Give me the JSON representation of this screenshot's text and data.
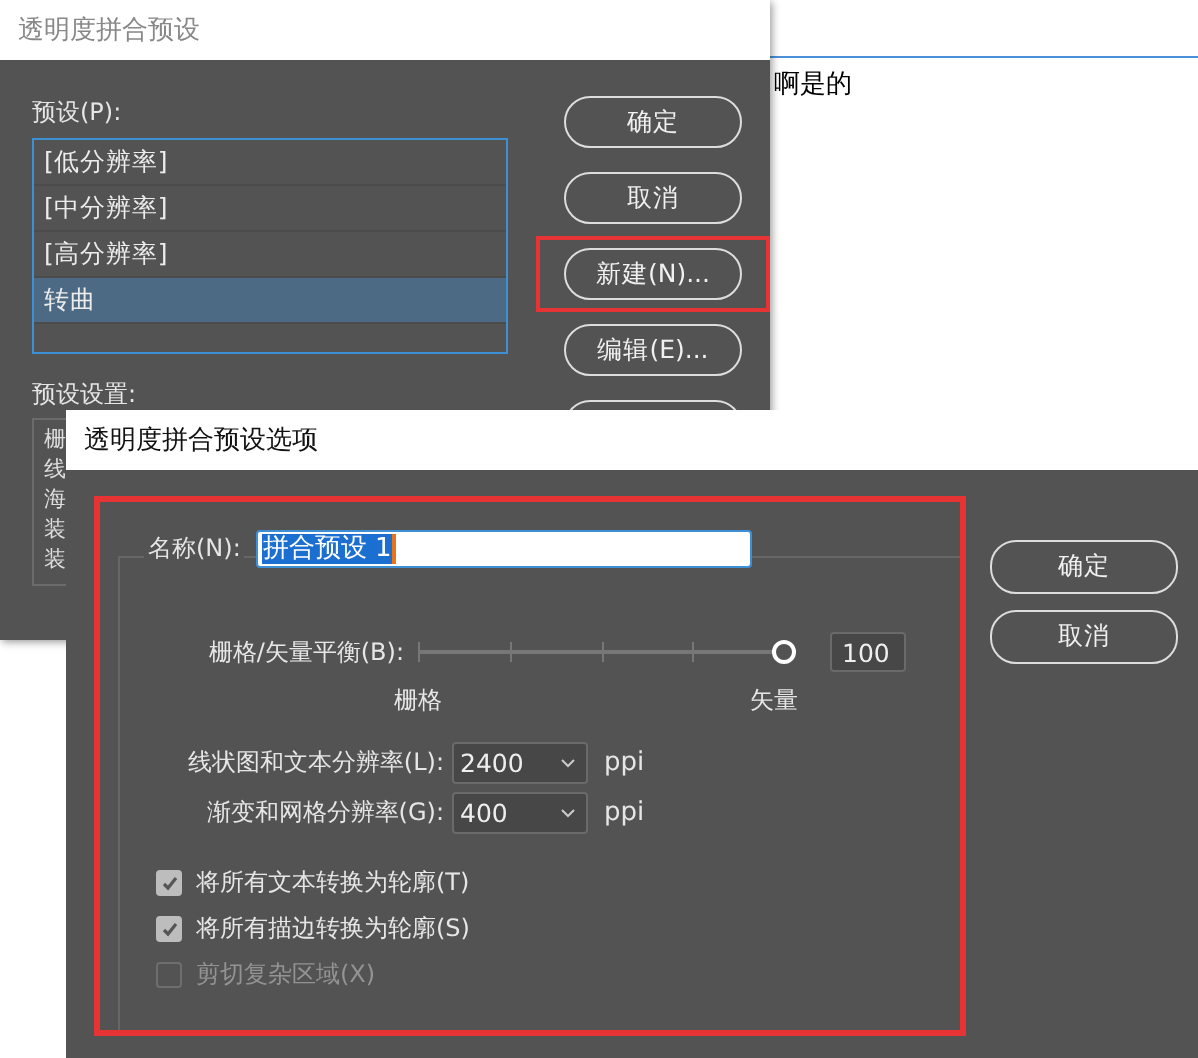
{
  "background_document": {
    "text": "啊是的"
  },
  "preset_dialog": {
    "title": "透明度拼合预设",
    "presets_label": "预设(P):",
    "presets": [
      {
        "label": "[低分辨率]",
        "selected": false
      },
      {
        "label": "[中分辨率]",
        "selected": false
      },
      {
        "label": "[高分辨率]",
        "selected": false
      },
      {
        "label": "转曲",
        "selected": true
      }
    ],
    "buttons": [
      {
        "label": "确定",
        "highlighted": false
      },
      {
        "label": "取消",
        "highlighted": false
      },
      {
        "label": "新建(N)...",
        "highlighted": true
      },
      {
        "label": "编辑(E)...",
        "highlighted": false
      }
    ],
    "settings_label": "预设设置:",
    "settings_lines": [
      "栅",
      "线",
      "海",
      "装",
      "装"
    ]
  },
  "options_dialog": {
    "title": "透明度拼合预设选项",
    "highlighted": true,
    "name_label": "名称(N):",
    "name_value": "拼合预设 1",
    "balance": {
      "label": "栅格/矢量平衡(B):",
      "level": 1,
      "value": "100",
      "min_label": "栅格",
      "max_label": "矢量"
    },
    "resolutions": [
      {
        "label": "线状图和文本分辨率(L):",
        "value": "2400",
        "unit": "ppi"
      },
      {
        "label": "渐变和网格分辨率(G):",
        "value": "400",
        "unit": "ppi"
      }
    ],
    "options": [
      {
        "label": "将所有文本转换为轮廓(T)",
        "checked": true,
        "disabled": false
      },
      {
        "label": "将所有描边转换为轮廓(S)",
        "checked": true,
        "disabled": false
      },
      {
        "label": "剪切复杂区域(X)",
        "checked": false,
        "disabled": true
      }
    ],
    "buttons": [
      "确定",
      "取消"
    ]
  }
}
